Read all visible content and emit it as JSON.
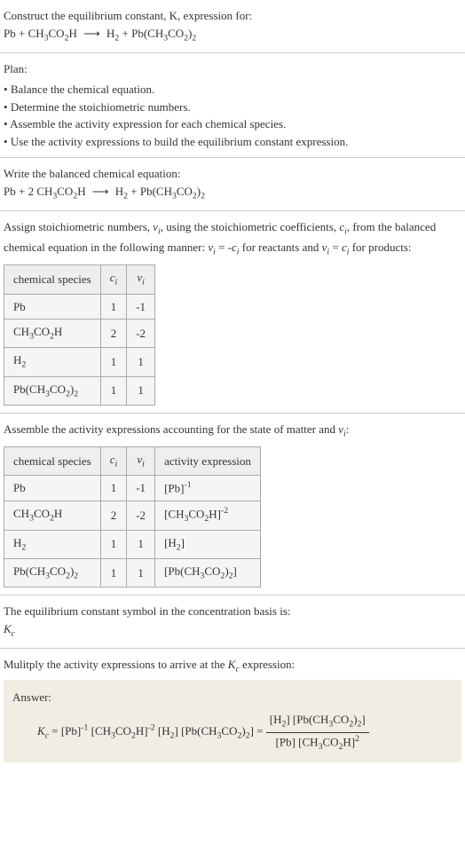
{
  "intro": {
    "line1": "Construct the equilibrium constant, K, expression for:",
    "equation_lhs_pb": "Pb",
    "equation_lhs_ch": "CH",
    "equation_lhs_co": "CO",
    "equation_lhs_h": "H",
    "equation_rhs_h": "H",
    "equation_rhs_pb": "Pb(CH",
    "equation_rhs_co": "CO",
    "arrow": "⟶",
    "plus": "+"
  },
  "plan": {
    "header": "Plan:",
    "items": [
      "Balance the chemical equation.",
      "Determine the stoichiometric numbers.",
      "Assemble the activity expression for each chemical species.",
      "Use the activity expressions to build the equilibrium constant expression."
    ]
  },
  "balanced": {
    "header": "Write the balanced chemical equation:",
    "coef_2": "2"
  },
  "stoich": {
    "text_part1": "Assign stoichiometric numbers, ",
    "nu_i": "ν",
    "text_part2": ", using the stoichiometric coefficients, ",
    "c_i": "c",
    "text_part3": ", from the balanced chemical equation in the following manner: ",
    "rel_react": " = -",
    "text_react": " for reactants and ",
    "eq": " = ",
    "text_prod": " for products:",
    "table1_h1": "chemical species",
    "rows": [
      {
        "species_pre": "Pb",
        "species_sub": "",
        "c": "1",
        "nu": "-1"
      },
      {
        "species_pre": "CH",
        "species_sub": "3",
        "species_mid": "CO",
        "species_sub2": "2",
        "species_end": "H",
        "c": "2",
        "nu": "-2"
      },
      {
        "species_pre": "H",
        "species_sub": "2",
        "c": "1",
        "nu": "1"
      },
      {
        "species_pre": "Pb(CH",
        "species_sub": "3",
        "species_mid": "CO",
        "species_sub2": "2",
        "species_end": ")",
        "species_sub3": "2",
        "c": "1",
        "nu": "1"
      }
    ]
  },
  "activity": {
    "header": "Assemble the activity expressions accounting for the state of matter and ",
    "header_end": ":",
    "col_activity": "activity expression",
    "rows": [
      {
        "expr_open": "[Pb]",
        "exp": "-1"
      },
      {
        "expr_open": "[CH",
        "expr_close": "H]",
        "exp": "-2"
      },
      {
        "expr_open": "[H",
        "expr_close": "]",
        "exp": ""
      },
      {
        "expr_open": "[Pb(CH",
        "expr_close": ")",
        "expr_close2": "]",
        "exp": ""
      }
    ]
  },
  "basis": {
    "text": "The equilibrium constant symbol in the concentration basis is:",
    "kc": "K",
    "sub_c": "c"
  },
  "multiply": {
    "text": "Mulitply the activity expressions to arrive at the ",
    "text_end": " expression:"
  },
  "answer": {
    "label": "Answer:",
    "eq": " = "
  }
}
